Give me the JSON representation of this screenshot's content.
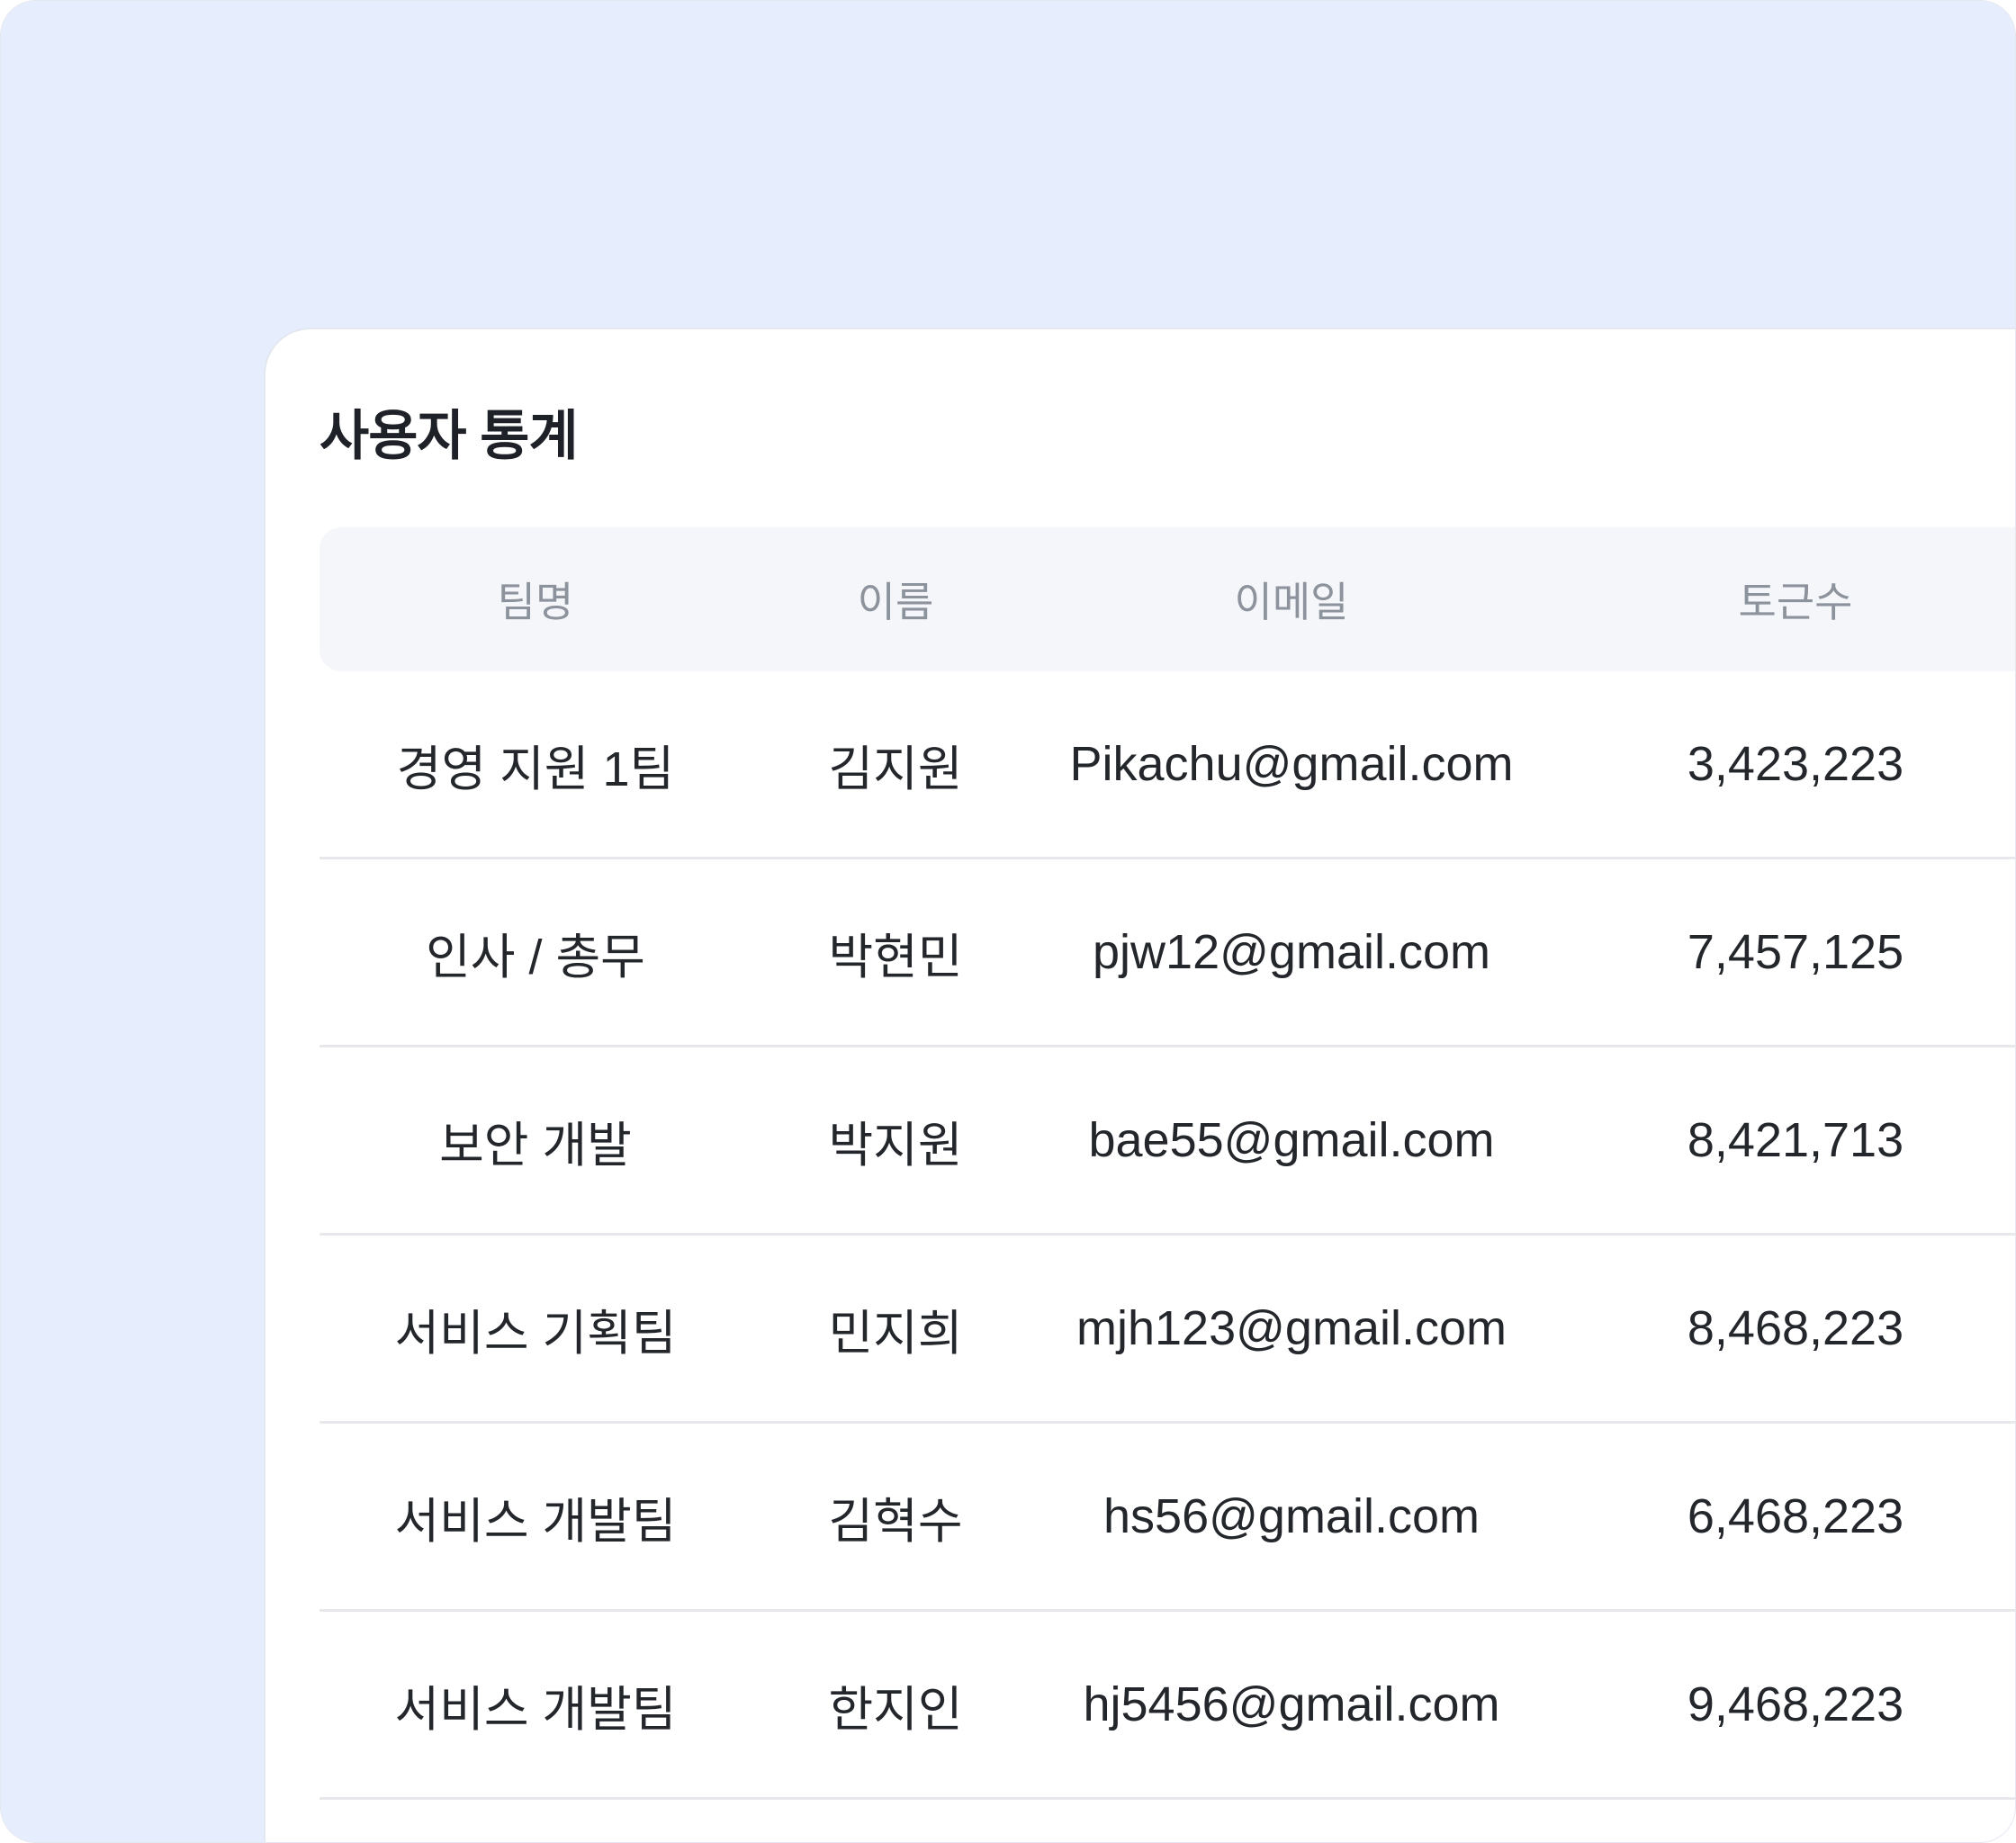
{
  "panel": {
    "title": "사용자 통계"
  },
  "table": {
    "headers": [
      "팀명",
      "이름",
      "이메일",
      "토근수"
    ],
    "rows": [
      [
        "경영 지원 1팀",
        "김지원",
        "Pikachu@gmail.com",
        "3,423,223"
      ],
      [
        "인사 / 총무",
        "박현민",
        "pjw12@gmail.com",
        "7,457,125"
      ],
      [
        "보안 개발",
        "박지원",
        "bae55@gmail.com",
        "8,421,713"
      ],
      [
        "서비스 기획팀",
        "민지희",
        "mjh123@gmail.com",
        "8,468,223"
      ],
      [
        "서비스 개발팀",
        "김혁수",
        "hs56@gmail.com",
        "6,468,223"
      ],
      [
        "서비스 개발팀",
        "한지인",
        "hj5456@gmail.com",
        "9,468,223"
      ]
    ]
  },
  "colors": {
    "background": "#e6edfd",
    "card": "#ffffff",
    "header_row": "#f4f6f9",
    "header_text": "#8d939c",
    "body_text": "#23262b",
    "divider": "#e6e8ec"
  }
}
